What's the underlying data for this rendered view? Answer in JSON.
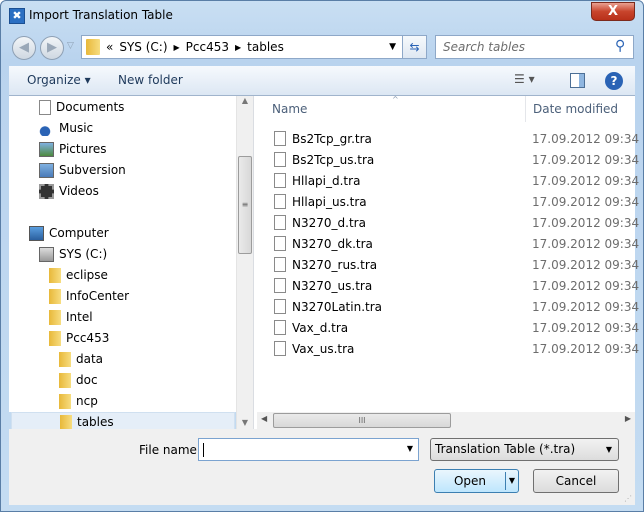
{
  "window": {
    "title": "Import Translation Table",
    "close": "X"
  },
  "address": {
    "prefix": "«",
    "crumbs": [
      "SYS (C:)",
      "Pcc453",
      "tables"
    ],
    "search_placeholder": "Search tables"
  },
  "toolbar": {
    "organize": "Organize ▾",
    "new_folder": "New folder"
  },
  "nav": [
    {
      "label": "Documents",
      "level": 1,
      "icon": "documents-icon"
    },
    {
      "label": "Music",
      "level": 1,
      "icon": "music-icon"
    },
    {
      "label": "Pictures",
      "level": 1,
      "icon": "pictures-icon"
    },
    {
      "label": "Subversion",
      "level": 1,
      "icon": "subversion-icon"
    },
    {
      "label": "Videos",
      "level": 1,
      "icon": "videos-icon"
    },
    {
      "label": "Computer",
      "level": 0,
      "icon": "computer-icon"
    },
    {
      "label": "SYS (C:)",
      "level": 1,
      "icon": "drive-icon"
    },
    {
      "label": "eclipse",
      "level": 2,
      "icon": "folder-icon"
    },
    {
      "label": "InfoCenter",
      "level": 2,
      "icon": "folder-icon"
    },
    {
      "label": "Intel",
      "level": 2,
      "icon": "folder-icon"
    },
    {
      "label": "Pcc453",
      "level": 2,
      "icon": "folder-icon"
    },
    {
      "label": "data",
      "level": 3,
      "icon": "folder-icon"
    },
    {
      "label": "doc",
      "level": 3,
      "icon": "folder-icon"
    },
    {
      "label": "ncp",
      "level": 3,
      "icon": "folder-icon"
    },
    {
      "label": "tables",
      "level": 3,
      "icon": "folder-icon",
      "selected": true
    }
  ],
  "list": {
    "columns": [
      "Name",
      "Date modified"
    ],
    "files": [
      {
        "name": "Bs2Tcp_gr.tra",
        "date": "17.09.2012 09:34"
      },
      {
        "name": "Bs2Tcp_us.tra",
        "date": "17.09.2012 09:34"
      },
      {
        "name": "Hllapi_d.tra",
        "date": "17.09.2012 09:34"
      },
      {
        "name": "Hllapi_us.tra",
        "date": "17.09.2012 09:34"
      },
      {
        "name": "N3270_d.tra",
        "date": "17.09.2012 09:34"
      },
      {
        "name": "N3270_dk.tra",
        "date": "17.09.2012 09:34"
      },
      {
        "name": "N3270_rus.tra",
        "date": "17.09.2012 09:34"
      },
      {
        "name": "N3270_us.tra",
        "date": "17.09.2012 09:34"
      },
      {
        "name": "N3270Latin.tra",
        "date": "17.09.2012 09:34"
      },
      {
        "name": "Vax_d.tra",
        "date": "17.09.2012 09:34"
      },
      {
        "name": "Vax_us.tra",
        "date": "17.09.2012 09:34"
      }
    ]
  },
  "footer": {
    "file_name_label": "File name:",
    "file_name_value": "",
    "file_type": "Translation Table (*.tra)",
    "open": "Open",
    "cancel": "Cancel"
  }
}
